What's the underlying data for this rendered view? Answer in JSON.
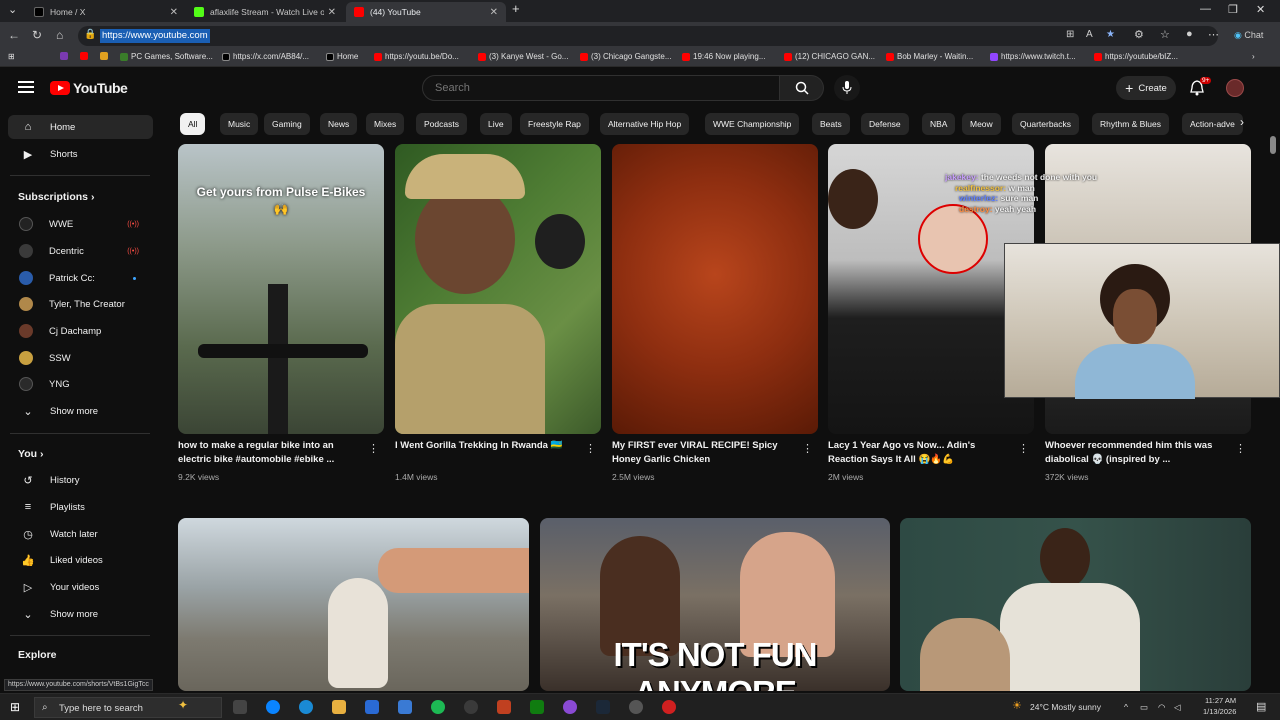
{
  "browser": {
    "tabs": [
      {
        "title": "Home / X",
        "active": false,
        "color": "#000000"
      },
      {
        "title": "aflaxlife Stream - Watch Live on K",
        "active": false,
        "color": "#53fc18"
      },
      {
        "title": "(44) YouTube",
        "active": true,
        "color": "#ff0000"
      }
    ],
    "url": "https://www.youtube.com",
    "bookmarks": [
      {
        "label": "PC Games, Software...",
        "color": "#3a7d2a"
      },
      {
        "label": "https://x.com/AB84/...",
        "color": "#000000"
      },
      {
        "label": "Home",
        "color": "#000000"
      },
      {
        "label": "https://youtu.be/Do...",
        "color": "#ff0000"
      },
      {
        "label": "(3) Kanye West - Go...",
        "color": "#ff0000"
      },
      {
        "label": "(3) Chicago Gangste...",
        "color": "#ff0000"
      },
      {
        "label": "19:46 Now playing...",
        "color": "#ff0000"
      },
      {
        "label": "(12) CHICAGO GAN...",
        "color": "#ff0000"
      },
      {
        "label": "Bob Marley - Waitin...",
        "color": "#ff0000"
      },
      {
        "label": "https://www.twitch.t...",
        "color": "#9146ff"
      },
      {
        "label": "https://youtube/bIZ...",
        "color": "#ff0000"
      }
    ],
    "chat_label": "Chat"
  },
  "header": {
    "logo": "YouTube",
    "search_placeholder": "Search",
    "create_label": "Create",
    "notification_count": "9+"
  },
  "sidebar": {
    "main": [
      {
        "label": "Home",
        "icon": "home-icon",
        "active": true
      },
      {
        "label": "Shorts",
        "icon": "shorts-icon",
        "active": false
      }
    ],
    "subscriptions_title": "Subscriptions",
    "subscriptions": [
      {
        "label": "WWE",
        "color": "#222222",
        "status": "live"
      },
      {
        "label": "Dcentric",
        "color": "#3a3a3a",
        "status": "live"
      },
      {
        "label": "Patrick Cc:",
        "color": "#2a5caa",
        "status": "new"
      },
      {
        "label": "Tyler, The Creator",
        "color": "#b0884a",
        "status": ""
      },
      {
        "label": "Cj Dachamp",
        "color": "#6a3a2a",
        "status": ""
      },
      {
        "label": "SSW",
        "color": "#c8a040",
        "status": ""
      },
      {
        "label": "YNG",
        "color": "#2a2a2a",
        "status": ""
      }
    ],
    "show_more": "Show more",
    "you_title": "You",
    "you_items": [
      {
        "label": "History",
        "icon": "history-icon"
      },
      {
        "label": "Playlists",
        "icon": "playlists-icon"
      },
      {
        "label": "Watch later",
        "icon": "watch-later-icon"
      },
      {
        "label": "Liked videos",
        "icon": "like-icon"
      },
      {
        "label": "Your videos",
        "icon": "your-videos-icon"
      }
    ],
    "show_more_2": "Show more",
    "explore_title": "Explore"
  },
  "chips": [
    "All",
    "Music",
    "Gaming",
    "News",
    "Mixes",
    "Podcasts",
    "Live",
    "Freestyle Rap",
    "Alternative Hip Hop",
    "WWE Championship",
    "Beats",
    "Defense",
    "NBA",
    "Meow",
    "Quarterbacks",
    "Rhythm & Blues",
    "Action-adve"
  ],
  "shorts": [
    {
      "title": "how to make a regular bike into an electric bike #automobile #ebike ...",
      "views": "9.2K views",
      "overlay": "Get yours from Pulse E-Bikes 🙌"
    },
    {
      "title": "I Went Gorilla Trekking In Rwanda 🇷🇼",
      "views": "1.4M views",
      "overlay": ""
    },
    {
      "title": "My FIRST ever VIRAL RECIPE! Spicy Honey Garlic Chicken",
      "views": "2.5M views",
      "overlay": ""
    },
    {
      "title": "Lacy 1 Year Ago vs Now... Adin's Reaction Says It All 😭🔥💪",
      "views": "2M views",
      "overlay": ""
    },
    {
      "title": "Whoever recommended him this was diabolical 💀 (inspired by ...",
      "views": "372K views",
      "overlay": ""
    }
  ],
  "chat_overlay": [
    {
      "user": "jakekey:",
      "msg": "the weeds not done with you"
    },
    {
      "user": "realfinessor:",
      "msg": "w man"
    },
    {
      "user": "winterlez:",
      "msg": "sure man"
    },
    {
      "user": "destroy:",
      "msg": "yeah yeah"
    }
  ],
  "videos_row2": [
    {
      "overlay": ""
    },
    {
      "overlay": "IT'S NOT FUN ANYMORE"
    },
    {
      "overlay": ""
    }
  ],
  "status_url": "https://www.youtube.com/shorts/VtBs1GigTcc",
  "taskbar": {
    "search_placeholder": "Type here to search",
    "weather": "24°C  Mostly sunny",
    "time": "11:27 AM",
    "date": "1/13/2026"
  }
}
